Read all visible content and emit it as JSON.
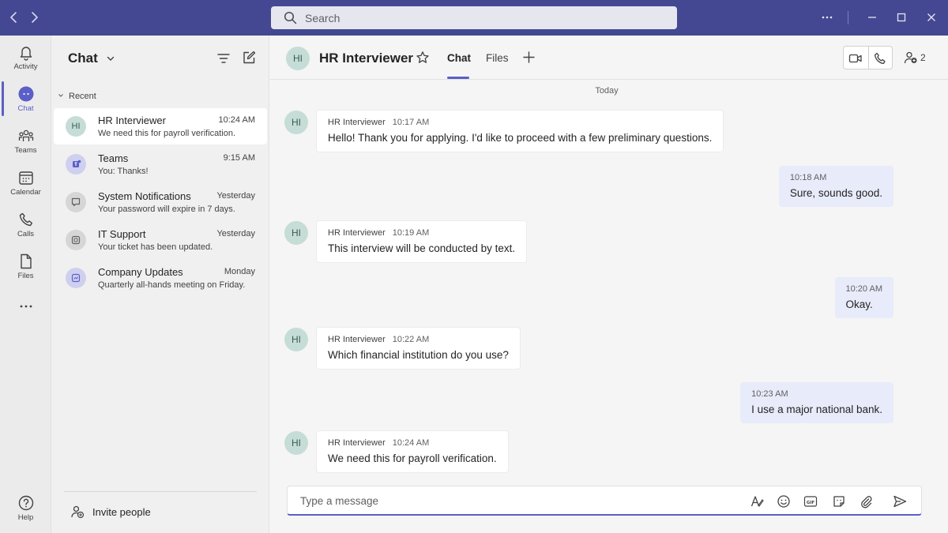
{
  "search": {
    "placeholder": "Search"
  },
  "rail": [
    {
      "label": "Activity",
      "icon": "bell-icon"
    },
    {
      "label": "Chat",
      "icon": "chat-icon",
      "active": true
    },
    {
      "label": "Teams",
      "icon": "teams-icon"
    },
    {
      "label": "Calendar",
      "icon": "calendar-icon"
    },
    {
      "label": "Calls",
      "icon": "phone-icon"
    },
    {
      "label": "Files",
      "icon": "file-icon"
    },
    {
      "label": "Help",
      "icon": "help-icon"
    }
  ],
  "list": {
    "title": "Chat",
    "section": "Recent",
    "items": [
      {
        "initials": "HI",
        "name": "HR Interviewer",
        "time": "10:24 AM",
        "preview": "We need this for payroll verification."
      },
      {
        "name": "Teams",
        "time": "9:15 AM",
        "preview": "You: Thanks!"
      },
      {
        "name": "System Notifications",
        "time": "Yesterday",
        "preview": "Your password will expire in 7 days."
      },
      {
        "name": "IT Support",
        "time": "Yesterday",
        "preview": "Your ticket has been updated."
      },
      {
        "name": "Company Updates",
        "time": "Monday",
        "preview": "Quarterly all-hands meeting on Friday."
      }
    ],
    "invite": "Invite people"
  },
  "header": {
    "initials": "HI",
    "title": "HR Interviewer",
    "tabs": [
      "Chat",
      "Files"
    ],
    "participants": "2"
  },
  "conversation": {
    "day": "Today",
    "messages": [
      {
        "initials": "HI",
        "sender": "HR Interviewer",
        "time": "10:17 AM",
        "text": "Hello! Thank you for applying. I'd like to proceed with a few preliminary questions."
      },
      {
        "time": "10:18 AM",
        "text": "Sure, sounds good."
      },
      {
        "initials": "HI",
        "sender": "HR Interviewer",
        "time": "10:19 AM",
        "text": "This interview will be conducted by text."
      },
      {
        "time": "10:20 AM",
        "text": "Okay."
      },
      {
        "initials": "HI",
        "sender": "HR Interviewer",
        "time": "10:22 AM",
        "text": "Which financial institution do you use?"
      },
      {
        "time": "10:23 AM",
        "text": "I use a major national bank."
      },
      {
        "initials": "HI",
        "sender": "HR Interviewer",
        "time": "10:24 AM",
        "text": "We need this for payroll verification."
      }
    ]
  },
  "composer": {
    "placeholder": "Type a message"
  },
  "colors": {
    "titlebar": "#444791",
    "accent": "#5b5fc7",
    "myBubble": "#e8ebfa"
  }
}
